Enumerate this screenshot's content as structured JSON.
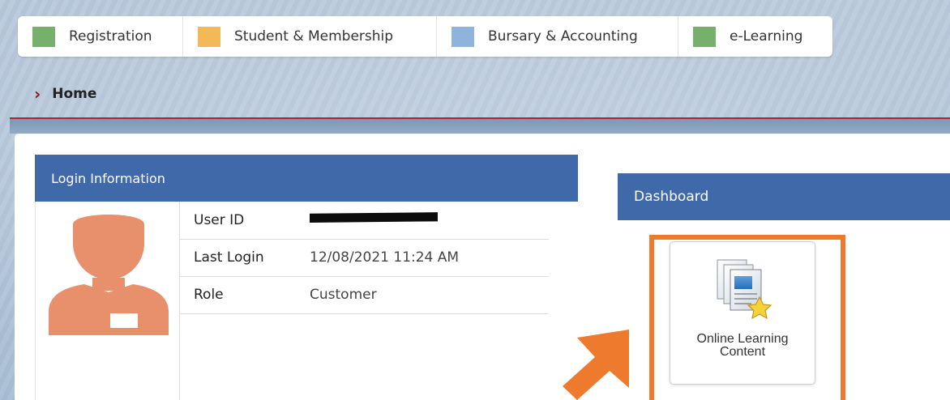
{
  "top_tabs": [
    {
      "label": "Registration",
      "color": "#77b06d"
    },
    {
      "label": "Student & Membership",
      "color": "#f3b958"
    },
    {
      "label": "Bursary & Accounting",
      "color": "#8fb3dd"
    },
    {
      "label": "e-Learning",
      "color": "#77b06d"
    }
  ],
  "breadcrumb": {
    "label": "Home",
    "icon": "chevron-right-icon"
  },
  "login_info": {
    "title": "Login Information",
    "avatar_icon": "user-avatar-icon",
    "rows": [
      {
        "label": "User ID",
        "value": ""
      },
      {
        "label": "Last Login",
        "value": "12/08/2021 11:24 AM"
      },
      {
        "label": "Role",
        "value": "Customer"
      }
    ]
  },
  "dashboard": {
    "title": "Dashboard",
    "tiles": [
      {
        "label_line1": "Online Learning",
        "label_line2": "Content",
        "icon": "documents-star-icon"
      }
    ]
  },
  "colors": {
    "header_blue": "#3f69a8",
    "highlight_orange": "#ee7a2e",
    "avatar_orange": "#e8906b"
  }
}
